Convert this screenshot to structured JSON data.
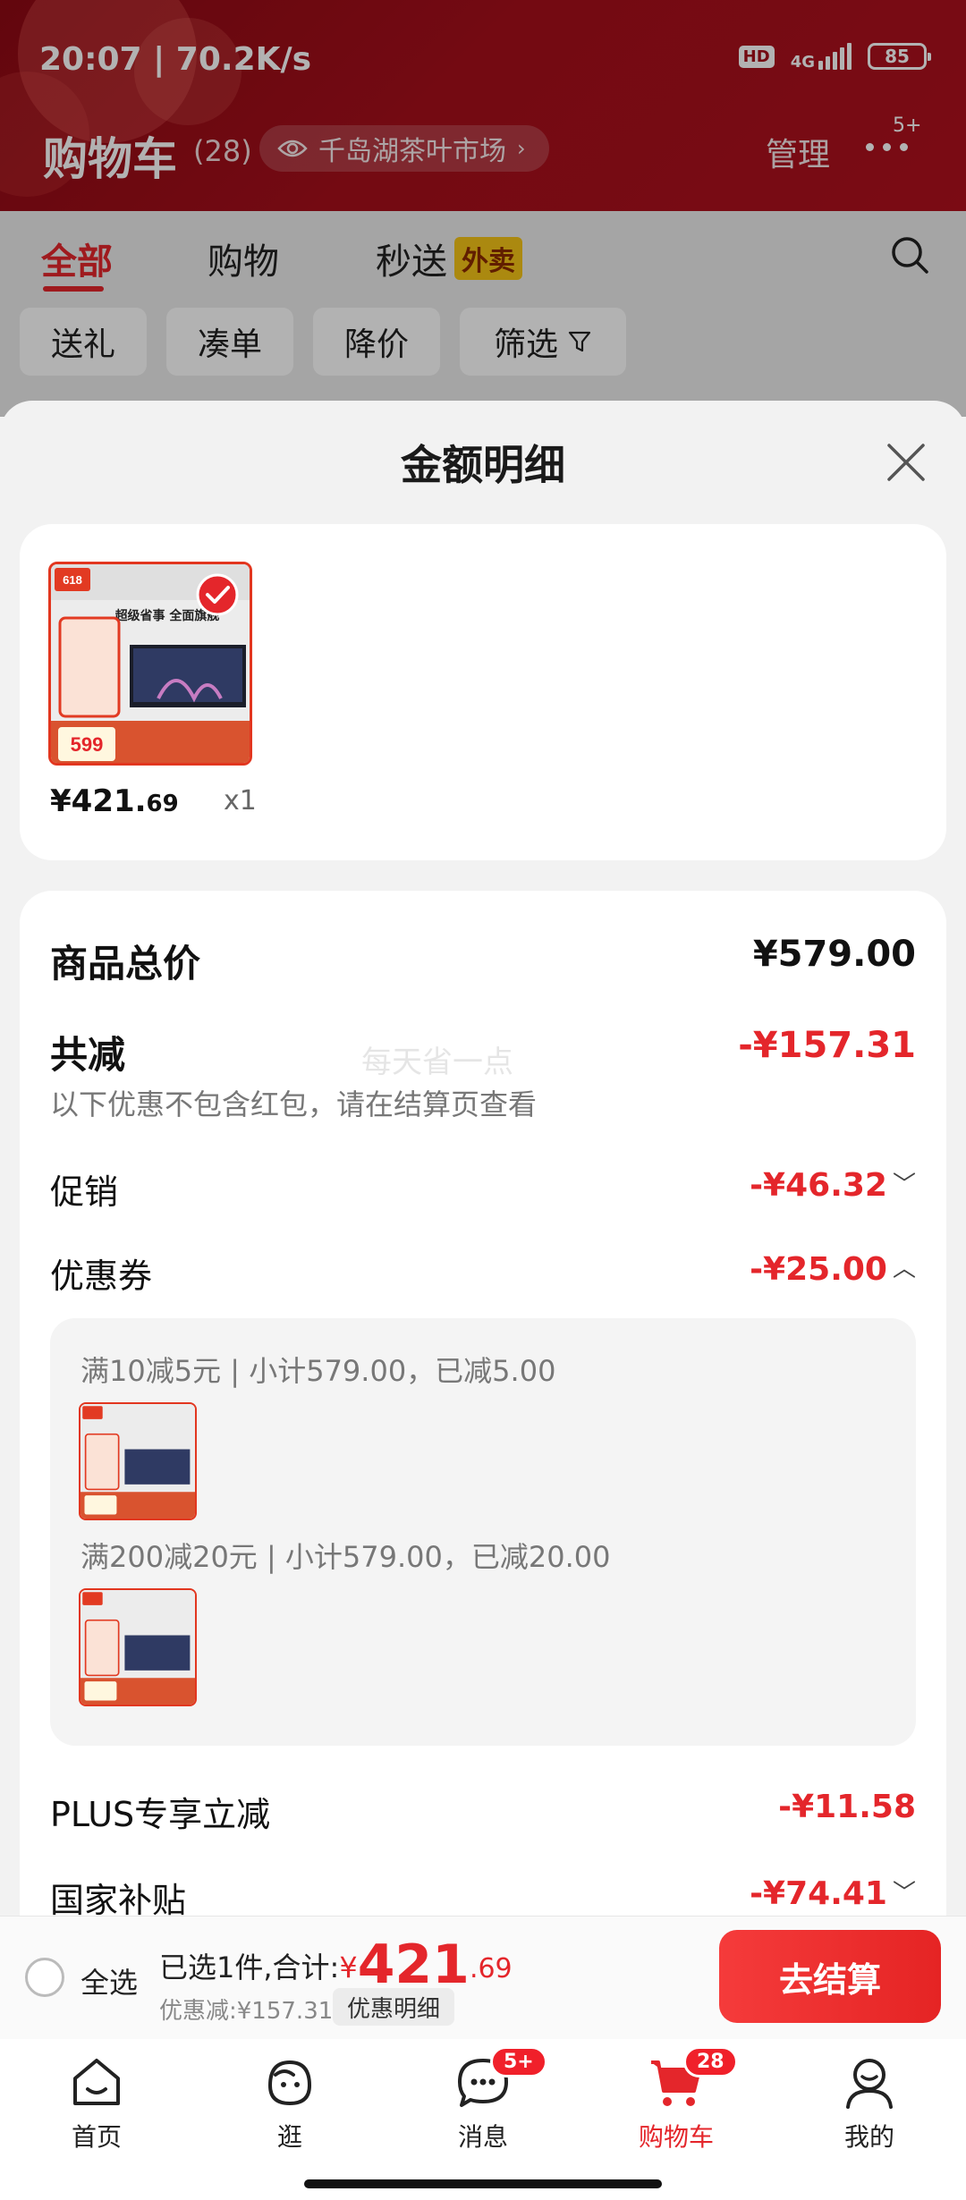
{
  "status_bar": {
    "time_speed": "20:07 | 70.2K/s",
    "hd": "HD",
    "network": "4G",
    "battery": "85"
  },
  "header": {
    "title": "购物车",
    "count": "(28)",
    "location": "千岛湖茶叶市场",
    "manage": "管理",
    "more_badge": "5+"
  },
  "tabs": [
    {
      "label": "全部"
    },
    {
      "label": "购物"
    },
    {
      "label": "秒送"
    }
  ],
  "waimai_tag": "外卖",
  "chips": [
    "送礼",
    "凑单",
    "降价",
    "筛选"
  ],
  "sheet": {
    "title": "金额明细",
    "product": {
      "price_int": "¥421.",
      "price_dec": "69",
      "qty": "x1",
      "poster_tag": "618",
      "poster_headline": "超级省事 全面旗舰",
      "poster_price": "599"
    },
    "total_label": "商品总价",
    "total_value": "¥579.00",
    "reduce_label": "共减",
    "reduce_value": "-¥157.31",
    "watermark": "每天省一点",
    "note": "以下优惠不包含红包，请在结算页查看",
    "promo_label": "促销",
    "promo_value": "-¥46.32",
    "coupon_label": "优惠券",
    "coupon_value": "-¥25.00",
    "coupon_lines": [
      "满10减5元 | 小计579.00，已减5.00",
      "满200减20元 | 小计579.00，已减20.00"
    ],
    "plus_label": "PLUS专享立减",
    "plus_value": "-¥11.58",
    "subsidy_label": "国家补贴",
    "subsidy_value": "-¥74.41"
  },
  "checkout": {
    "select_all": "全选",
    "summary_prefix": "已选1件,合计:",
    "yen": "¥",
    "amount_int": "421",
    "amount_dec": ".69",
    "discount_text": "优惠减:¥157.31",
    "detail_btn": "优惠明细",
    "checkout_btn": "去结算"
  },
  "bottom_nav": [
    {
      "label": "首页"
    },
    {
      "label": "逛"
    },
    {
      "label": "消息",
      "badge": "5+"
    },
    {
      "label": "购物车",
      "badge": "28"
    },
    {
      "label": "我的"
    }
  ]
}
